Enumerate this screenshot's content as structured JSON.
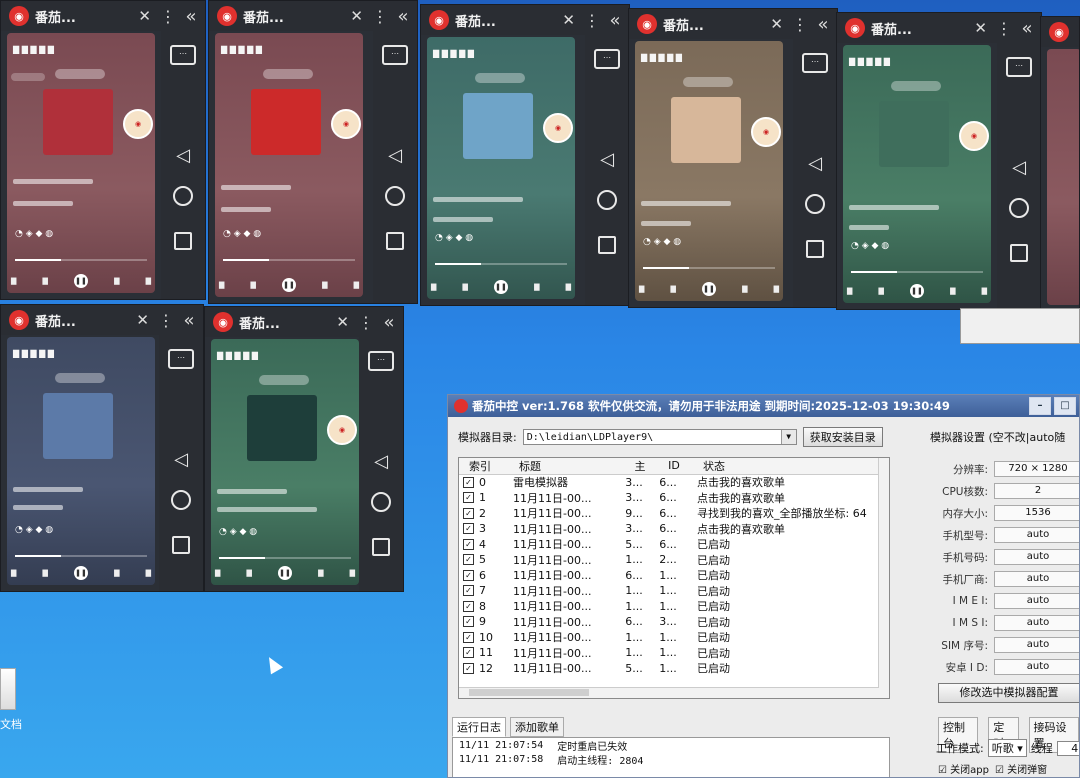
{
  "emulators": [
    {
      "app_name": "番茄...",
      "theme": "t-red",
      "cover": "#b0303a"
    },
    {
      "app_name": "番茄...",
      "theme": "t-red",
      "cover": "#cc2a2a"
    },
    {
      "app_name": "番茄...",
      "theme": "t-teal",
      "cover": "#6fa4c8"
    },
    {
      "app_name": "番茄...",
      "theme": "t-sand",
      "cover": "#d7b79a"
    },
    {
      "app_name": "番茄...",
      "theme": "t-green",
      "cover": "#3f6e5c"
    },
    {
      "app_name": "番茄...",
      "theme": "t-navy",
      "cover": "#5c7aa8"
    },
    {
      "app_name": "番茄...",
      "theme": "t-green",
      "cover": "#1e3e3a"
    }
  ],
  "controller": {
    "title": "番茄中控 ver:1.768  软件仅供交流，请勿用于非法用途  到期时间:2025-12-03 19:30:49",
    "path_label": "模拟器目录:",
    "path_value": "D:\\leidian\\LDPlayer9\\",
    "get_path_button": "获取安装目录",
    "table_headers": {
      "idx": "索引",
      "title": "标题",
      "main": "主",
      "sub": "ID",
      "status": "状态"
    },
    "rows": [
      {
        "idx": "0",
        "title": "雷电模拟器",
        "main": "3...",
        "sub": "6...",
        "status": "点击我的喜欢歌单"
      },
      {
        "idx": "1",
        "title": "11月11日-00...",
        "main": "3...",
        "sub": "6...",
        "status": "点击我的喜欢歌单"
      },
      {
        "idx": "2",
        "title": "11月11日-00...",
        "main": "9...",
        "sub": "6...",
        "status": "寻找到我的喜欢_全部播放坐标: 64"
      },
      {
        "idx": "3",
        "title": "11月11日-00...",
        "main": "3...",
        "sub": "6...",
        "status": "点击我的喜欢歌单"
      },
      {
        "idx": "4",
        "title": "11月11日-00...",
        "main": "5...",
        "sub": "6...",
        "status": "已启动"
      },
      {
        "idx": "5",
        "title": "11月11日-00...",
        "main": "1...",
        "sub": "2...",
        "status": "已启动"
      },
      {
        "idx": "6",
        "title": "11月11日-00...",
        "main": "6...",
        "sub": "1...",
        "status": "已启动"
      },
      {
        "idx": "7",
        "title": "11月11日-00...",
        "main": "1...",
        "sub": "1...",
        "status": "已启动"
      },
      {
        "idx": "8",
        "title": "11月11日-00...",
        "main": "1...",
        "sub": "1...",
        "status": "已启动"
      },
      {
        "idx": "9",
        "title": "11月11日-00...",
        "main": "6...",
        "sub": "3...",
        "status": "已启动"
      },
      {
        "idx": "10",
        "title": "11月11日-00...",
        "main": "1...",
        "sub": "1...",
        "status": "已启动"
      },
      {
        "idx": "11",
        "title": "11月11日-00...",
        "main": "1...",
        "sub": "1...",
        "status": "已启动"
      },
      {
        "idx": "12",
        "title": "11月11日-00...",
        "main": "5...",
        "sub": "1...",
        "status": "已启动"
      }
    ],
    "settings_title": "模拟器设置 (空不改|auto随",
    "settings": [
      {
        "label": "分辨率:",
        "value": "720 × 1280"
      },
      {
        "label": "CPU核数:",
        "value": "2"
      },
      {
        "label": "内存大小:",
        "value": "1536"
      },
      {
        "label": "手机型号:",
        "value": "auto"
      },
      {
        "label": "手机号码:",
        "value": "auto"
      },
      {
        "label": "手机厂商:",
        "value": "auto"
      },
      {
        "label": "I M E I:",
        "value": "auto"
      },
      {
        "label": "I M S I:",
        "value": "auto"
      },
      {
        "label": "SIM 序号:",
        "value": "auto"
      },
      {
        "label": "安卓 I D:",
        "value": "auto"
      }
    ],
    "modify_button": "修改选中模拟器配置",
    "tabs": [
      "控制台",
      "定时",
      "接码设置"
    ],
    "mode_label": "工作模式:",
    "mode_value": "听歌",
    "thread_label": "线程",
    "thread_value": "4",
    "checks": [
      "关闭app",
      "关闭弹窗"
    ],
    "log_tabs": [
      "运行日志",
      "添加歌单"
    ],
    "logs": [
      {
        "time": "11/11 21:07:54",
        "msg": "定时重启已失效"
      },
      {
        "time": "11/11 21:07:58",
        "msg": "启动主线程: 2804"
      }
    ]
  },
  "desktop": {
    "label": "文档"
  }
}
